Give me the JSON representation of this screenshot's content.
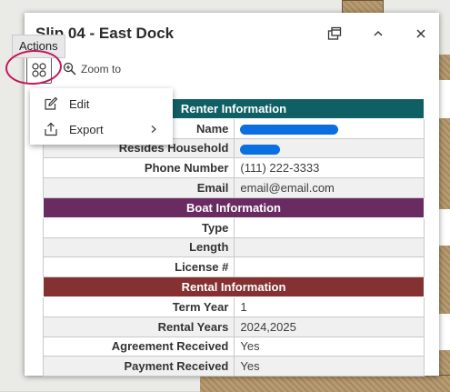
{
  "popup": {
    "title": "Slip 04 - East Dock",
    "dock_button": "dock",
    "collapse_button": "collapse",
    "close_button": "close"
  },
  "toolbar": {
    "actions_tooltip": "Actions",
    "zoom_label": "Zoom to"
  },
  "menu": {
    "items": [
      {
        "label": "Edit",
        "icon": "edit-icon"
      },
      {
        "label": "Export",
        "icon": "export-icon",
        "has_submenu": true
      }
    ]
  },
  "sections": {
    "renter": {
      "title": "Renter Information",
      "rows": [
        {
          "label": "Name",
          "value": ""
        },
        {
          "label": "Resides Household",
          "value": ""
        },
        {
          "label": "Phone Number",
          "value": "(111) 222-3333"
        },
        {
          "label": "Email",
          "value": "email@email.com"
        }
      ]
    },
    "boat": {
      "title": "Boat Information",
      "rows": [
        {
          "label": "Type",
          "value": ""
        },
        {
          "label": "Length",
          "value": ""
        },
        {
          "label": "License #",
          "value": ""
        }
      ]
    },
    "rental": {
      "title": "Rental Information",
      "rows": [
        {
          "label": "Term Year",
          "value": "1"
        },
        {
          "label": "Rental Years",
          "value": "2024,2025"
        },
        {
          "label": "Agreement Received",
          "value": "Yes"
        },
        {
          "label": "Payment Received",
          "value": "Yes"
        }
      ]
    }
  },
  "colors": {
    "renter_header": "#0f5f64",
    "boat_header": "#6a2b62",
    "rental_header": "#853031",
    "annotation_ring": "#c2185b",
    "redaction": "#0a6fe0"
  }
}
